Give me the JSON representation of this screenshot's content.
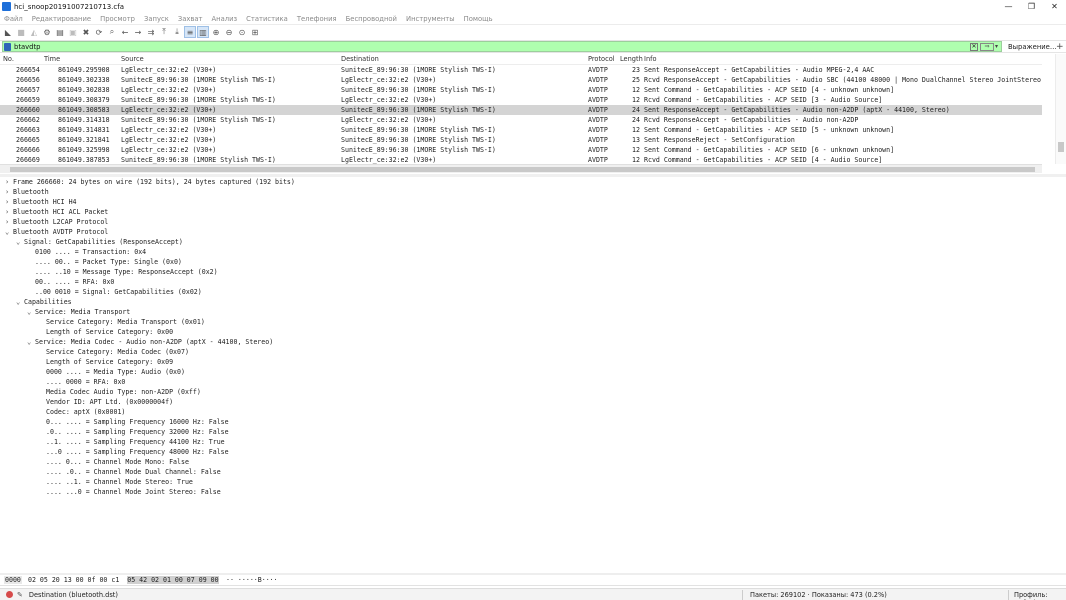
{
  "window": {
    "title": "hci_snoop20191007210713.cfa"
  },
  "winbtns": [
    "—",
    "❐",
    "✕"
  ],
  "menu": [
    "Файл",
    "Редактирование",
    "Просмотр",
    "Запуск",
    "Захват",
    "Анализ",
    "Статистика",
    "Телефония",
    "Беспроводной",
    "Инструменты",
    "Помощь"
  ],
  "toolbar": {
    "buttons": [
      "start-icon",
      "stop-icon",
      "restart-icon",
      "options-icon",
      "open-icon",
      "save-icon",
      "close-file-icon",
      "reload-icon",
      "find-icon",
      "back-icon",
      "forward-icon",
      "goto-icon",
      "first-icon",
      "last-icon",
      "autoscroll-icon",
      "colorize-icon",
      "zoom-in-icon",
      "zoom-out-icon",
      "zoom-normal-icon",
      "resize-columns-icon"
    ]
  },
  "filter": {
    "value": "btavdtp",
    "expression_label": "Выражение…",
    "plus": "+"
  },
  "columns": {
    "no": "No.",
    "time": "Time",
    "source": "Source",
    "destination": "Destination",
    "protocol": "Protocol",
    "length": "Length",
    "info": "Info"
  },
  "packets": [
    {
      "no": "266654",
      "time": "861049.295908",
      "src": "LgElectr_ce:32:e2 (V30+)",
      "dst": "SunitecE_89:96:30 (1MORE Stylish TWS-I)",
      "proto": "AVDTP",
      "len": "23",
      "info": "Sent ResponseAccept - GetCapabilities - Audio MPEG-2,4 AAC",
      "sel": false
    },
    {
      "no": "266656",
      "time": "861049.302338",
      "src": "SunitecE_89:96:30 (1MORE Stylish TWS-I)",
      "dst": "LgElectr_ce:32:e2 (V30+)",
      "proto": "AVDTP",
      "len": "25",
      "info": "Rcvd ResponseAccept - GetCapabilities - Audio SBC (44100 48000 | Mono DualChannel Stereo JointStereo",
      "sel": false
    },
    {
      "no": "266657",
      "time": "861049.302838",
      "src": "LgElectr_ce:32:e2 (V30+)",
      "dst": "SunitecE_89:96:30 (1MORE Stylish TWS-I)",
      "proto": "AVDTP",
      "len": "12",
      "info": "Sent Command - GetCapabilities - ACP SEID [4 - unknown unknown]",
      "sel": false
    },
    {
      "no": "266659",
      "time": "861049.308379",
      "src": "SunitecE_89:96:30 (1MORE Stylish TWS-I)",
      "dst": "LgElectr_ce:32:e2 (V30+)",
      "proto": "AVDTP",
      "len": "12",
      "info": "Rcvd Command - GetCapabilities - ACP SEID [3 - Audio Source]",
      "sel": false
    },
    {
      "no": "266660",
      "time": "861049.308583",
      "src": "LgElectr_ce:32:e2 (V30+)",
      "dst": "SunitecE_89:96:30 (1MORE Stylish TWS-I)",
      "proto": "AVDTP",
      "len": "24",
      "info": "Sent ResponseAccept - GetCapabilities - Audio non-A2DP (aptX - 44100, Stereo)",
      "sel": true
    },
    {
      "no": "266662",
      "time": "861049.314318",
      "src": "SunitecE_89:96:30 (1MORE Stylish TWS-I)",
      "dst": "LgElectr_ce:32:e2 (V30+)",
      "proto": "AVDTP",
      "len": "24",
      "info": "Rcvd ResponseAccept - GetCapabilities - Audio non-A2DP",
      "sel": false
    },
    {
      "no": "266663",
      "time": "861049.314831",
      "src": "LgElectr_ce:32:e2 (V30+)",
      "dst": "SunitecE_89:96:30 (1MORE Stylish TWS-I)",
      "proto": "AVDTP",
      "len": "12",
      "info": "Sent Command - GetCapabilities - ACP SEID [5 - unknown unknown]",
      "sel": false
    },
    {
      "no": "266665",
      "time": "861049.321841",
      "src": "LgElectr_ce:32:e2 (V30+)",
      "dst": "SunitecE_89:96:30 (1MORE Stylish TWS-I)",
      "proto": "AVDTP",
      "len": "13",
      "info": "Sent ResponseReject - SetConfiguration",
      "sel": false
    },
    {
      "no": "266666",
      "time": "861049.325998",
      "src": "LgElectr_ce:32:e2 (V30+)",
      "dst": "SunitecE_89:96:30 (1MORE Stylish TWS-I)",
      "proto": "AVDTP",
      "len": "12",
      "info": "Sent Command - GetCapabilities - ACP SEID [6 - unknown unknown]",
      "sel": false
    },
    {
      "no": "266669",
      "time": "861049.387853",
      "src": "SunitecE_89:96:30 (1MORE Stylish TWS-I)",
      "dst": "LgElectr_ce:32:e2 (V30+)",
      "proto": "AVDTP",
      "len": "12",
      "info": "Rcvd Command - GetCapabilities - ACP SEID [4 - Audio Source]",
      "sel": false
    }
  ],
  "details": [
    {
      "level": 0,
      "arrow": "›",
      "text": "Frame 266660: 24 bytes on wire (192 bits), 24 bytes captured (192 bits)"
    },
    {
      "level": 0,
      "arrow": "›",
      "text": "Bluetooth"
    },
    {
      "level": 0,
      "arrow": "›",
      "text": "Bluetooth HCI H4"
    },
    {
      "level": 0,
      "arrow": "›",
      "text": "Bluetooth HCI ACL Packet"
    },
    {
      "level": 0,
      "arrow": "›",
      "text": "Bluetooth L2CAP Protocol"
    },
    {
      "level": 0,
      "arrow": "⌄",
      "text": "Bluetooth AVDTP Protocol"
    },
    {
      "level": 1,
      "arrow": "⌄",
      "text": "Signal: GetCapabilities (ResponseAccept)"
    },
    {
      "level": 2,
      "arrow": "",
      "text": "0100 .... = Transaction: 0x4"
    },
    {
      "level": 2,
      "arrow": "",
      "text": ".... 00.. = Packet Type: Single (0x0)"
    },
    {
      "level": 2,
      "arrow": "",
      "text": ".... ..10 = Message Type: ResponseAccept (0x2)"
    },
    {
      "level": 2,
      "arrow": "",
      "text": "00.. .... = RFA: 0x0"
    },
    {
      "level": 2,
      "arrow": "",
      "text": "..00 0010 = Signal: GetCapabilities (0x02)"
    },
    {
      "level": 1,
      "arrow": "⌄",
      "text": "Capabilities"
    },
    {
      "level": 2,
      "arrow": "⌄",
      "text": "Service: Media Transport"
    },
    {
      "level": 3,
      "arrow": "",
      "text": "Service Category: Media Transport (0x01)"
    },
    {
      "level": 3,
      "arrow": "",
      "text": "Length of Service Category: 0x00"
    },
    {
      "level": 2,
      "arrow": "⌄",
      "text": "Service: Media Codec - Audio non-A2DP (aptX - 44100, Stereo)"
    },
    {
      "level": 3,
      "arrow": "",
      "text": "Service Category: Media Codec (0x07)"
    },
    {
      "level": 3,
      "arrow": "",
      "text": "Length of Service Category: 0x09"
    },
    {
      "level": 3,
      "arrow": "",
      "text": "0000 .... = Media Type: Audio (0x0)"
    },
    {
      "level": 3,
      "arrow": "",
      "text": ".... 0000 = RFA: 0x0"
    },
    {
      "level": 3,
      "arrow": "",
      "text": "Media Codec Audio Type: non-A2DP (0xff)"
    },
    {
      "level": 3,
      "arrow": "",
      "text": "Vendor ID: APT Ltd. (0x0000004f)"
    },
    {
      "level": 3,
      "arrow": "",
      "text": "Codec: aptX (0x0001)"
    },
    {
      "level": 3,
      "arrow": "",
      "text": "0... .... = Sampling Frequency 16000 Hz: False"
    },
    {
      "level": 3,
      "arrow": "",
      "text": ".0.. .... = Sampling Frequency 32000 Hz: False"
    },
    {
      "level": 3,
      "arrow": "",
      "text": "..1. .... = Sampling Frequency 44100 Hz: True"
    },
    {
      "level": 3,
      "arrow": "",
      "text": "...0 .... = Sampling Frequency 48000 Hz: False"
    },
    {
      "level": 3,
      "arrow": "",
      "text": ".... 0... = Channel Mode Mono: False"
    },
    {
      "level": 3,
      "arrow": "",
      "text": ".... .0.. = Channel Mode Dual Channel: False"
    },
    {
      "level": 3,
      "arrow": "",
      "text": ".... ..1. = Channel Mode Stereo: True"
    },
    {
      "level": 3,
      "arrow": "",
      "text": ".... ...0 = Channel Mode Joint Stereo: False"
    }
  ],
  "bytes": {
    "offset": "0000",
    "hex_a": "02 05 20 13 00 0f 00 c1",
    "hex_b": "05 42 02 01 00 07 09 00",
    "ascii": "·· ·····B····"
  },
  "status": {
    "field": "Destination (bluetooth.dst)",
    "packets": "Пакеты: 269102 · Показаны: 473 (0.2%)",
    "profile": "Профиль: Default"
  }
}
